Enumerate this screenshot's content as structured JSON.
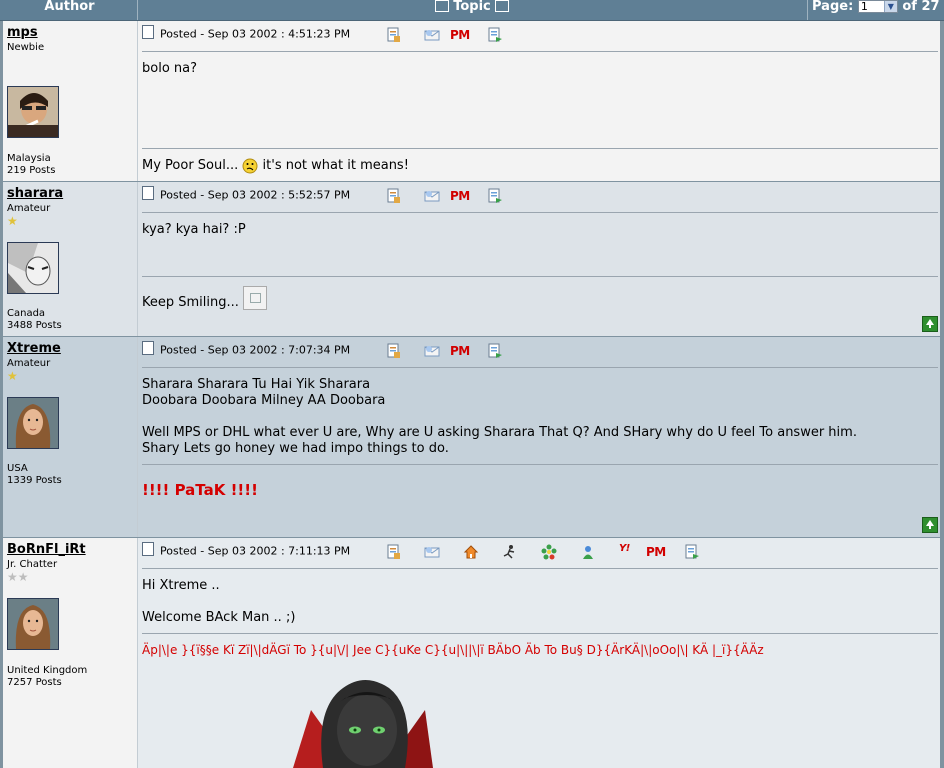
{
  "header": {
    "author_label": "Author",
    "topic_label": "Topic",
    "page_label": "Page:",
    "page_value": "1",
    "page_of": "of 27"
  },
  "posts": [
    {
      "username": "mps",
      "rank": "Newbie",
      "stars": "",
      "location": "Malaysia",
      "post_count": "219 Posts",
      "posted": "Posted - Sep 03 2002 :  4:51:23 PM",
      "pm_label": "PM",
      "body": "bolo na?",
      "signature_before": "My Poor Soul...",
      "signature_after": "it's not what it means!"
    },
    {
      "username": "sharara",
      "rank": "Amateur",
      "stars": "★",
      "location": "Canada",
      "post_count": "3488 Posts",
      "posted": "Posted - Sep 03 2002 :  5:52:57 PM",
      "pm_label": "PM",
      "body": "kya? kya hai? :P",
      "signature": "Keep Smiling..."
    },
    {
      "username": "Xtreme",
      "rank": "Amateur",
      "stars": "★",
      "location": "USA",
      "post_count": "1339 Posts",
      "posted": "Posted - Sep 03 2002 :  7:07:34 PM",
      "pm_label": "PM",
      "body": "Sharara Sharara Tu Hai Yik Sharara\nDoobara Doobara Milney AA Doobara\n\nWell MPS or DHL what ever U are, Why are U asking Sharara That Q? And SHary why do U feel To answer him.\nShary Lets go honey we had impo things to do.",
      "signature": "!!!! PaTaK !!!!"
    },
    {
      "username": "BoRnFl_iRt",
      "rank": "Jr. Chatter",
      "stars": "★★",
      "location": "United Kingdom",
      "post_count": "7257 Posts",
      "posted": "Posted - Sep 03 2002 :  7:11:13 PM",
      "pm_label": "PM",
      "body": "Hi Xtreme ..\n\nWelcome BAck Man .. ;)",
      "signature": "Äp|\\|e }{ï§§e Kï Zï|\\|dÄGï To }{u|\\/| Jee C}{uKe C}{u|\\||\\|ï BÄbO Äb To Bu§ D}{ÄrKÄ|\\|oOo|\\| KÄ |_ï}{ÄÄz"
    }
  ],
  "colors": {
    "header_bg": "#5f7f95",
    "row_light": "#f3f3f3",
    "row_blue": "#dde3e8",
    "row_dark": "#c5d1da",
    "pm_red": "#d10000",
    "signature_red": "#d40000"
  },
  "icons": [
    "doc-icon",
    "profile-icon",
    "email-icon",
    "pm-icon",
    "quote-icon",
    "homepage-icon",
    "aim-icon",
    "icq-icon",
    "msn-icon",
    "yahoo-icon",
    "go-top-icon",
    "prev-topic-icon",
    "next-topic-icon",
    "confused-smiley-icon"
  ]
}
